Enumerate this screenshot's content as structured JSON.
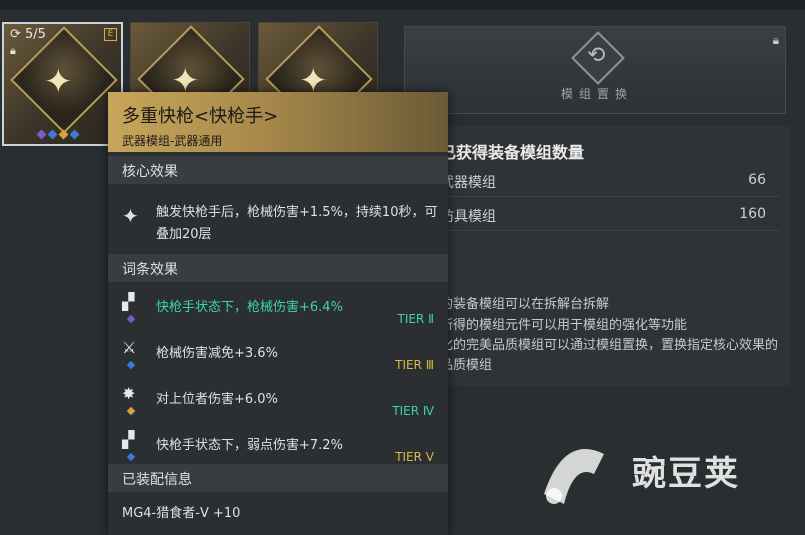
{
  "cards": {
    "selected_count": "5/5",
    "tag": "E",
    "lock_icon": "lock-icon",
    "dot_colors": [
      "#7a5bc7",
      "#3a7bd5",
      "#d9a23a",
      "#3a7bd5"
    ]
  },
  "swap": {
    "label": "模组置换",
    "icon": "swap-icon"
  },
  "info": {
    "title": "已获得装备模组数量",
    "rows": [
      {
        "label": "武器模组",
        "value": "66"
      },
      {
        "label": "防具模组",
        "value": "160"
      }
    ],
    "desc": [
      "的装备模组可以在拆解台拆解",
      "所得的模组元件可以用于模组的强化等功能",
      "化的完美品质模组可以通过模组置换，置换指定核心效果的",
      "品质模组"
    ]
  },
  "popup": {
    "title": "多重快枪<快枪手>",
    "subtitle": "武器模组-武器通用",
    "sections": {
      "core": "核心效果",
      "affix": "词条效果",
      "equipped": "已装配信息"
    },
    "core_text": "触发快枪手后，枪械伤害+1.5%，持续10秒，可叠加20层",
    "affixes": [
      {
        "text": "快枪手状态下，枪械伤害+6.4%",
        "tier": "TIER Ⅱ",
        "color": "#3fd0b0",
        "tier_color": "#3fd0b0",
        "dot": "#7a5bc7"
      },
      {
        "text": "枪械伤害减免+3.6%",
        "tier": "TIER Ⅲ",
        "color": "#e0e0e0",
        "tier_color": "#d8b84a",
        "dot": "#3a7bd5"
      },
      {
        "text": "对上位者伤害+6.0%",
        "tier": "TIER Ⅳ",
        "color": "#e0e0e0",
        "tier_color": "#3fd0b0",
        "dot": "#d9a23a"
      },
      {
        "text": "快枪手状态下，弱点伤害+7.2%",
        "tier": "TIER Ⅴ",
        "color": "#e0e0e0",
        "tier_color": "#d8b84a",
        "dot": "#3a7bd5"
      }
    ],
    "equipped_text": "MG4-猎食者-Ⅴ +10"
  },
  "watermark": "豌豆荚"
}
